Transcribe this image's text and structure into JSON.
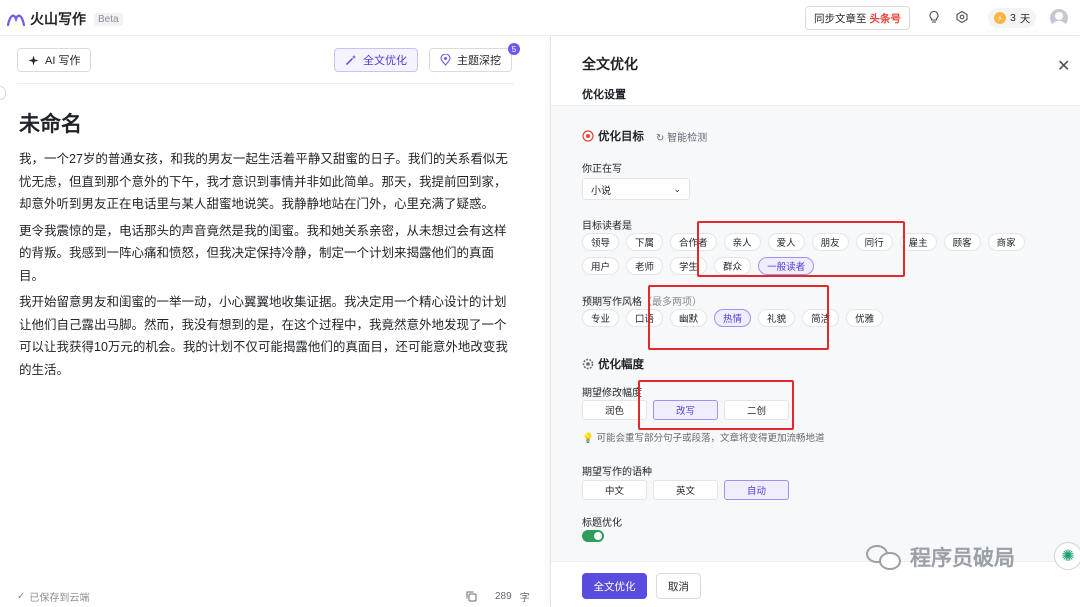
{
  "app": {
    "name": "火山写作",
    "badge": "Beta"
  },
  "topbar": {
    "sync_prefix": "同步文章至",
    "sync_target": "头条号",
    "days_value": "3",
    "days_unit": "天"
  },
  "editor": {
    "ai_button": "AI 写作",
    "optimize_button": "全文优化",
    "theme_button": "主题深挖",
    "theme_badge": "5",
    "title": "未命名",
    "paragraphs": [
      "我，一个27岁的普通女孩，和我的男友一起生活着平静又甜蜜的日子。我们的关系看似无忧无虑，但直到那个意外的下午，我才意识到事情并非如此简单。那天，我提前回到家，却意外听到男友正在电话里与某人甜蜜地说笑。我静静地站在门外，心里充满了疑惑。",
      "更令我震惊的是，电话那头的声音竟然是我的闺蜜。我和她关系亲密，从未想过会有这样的背叛。我感到一阵心痛和愤怒，但我决定保持冷静，制定一个计划来揭露他们的真面目。",
      "我开始留意男友和闺蜜的一举一动，小心翼翼地收集证据。我决定用一个精心设计的计划让他们自己露出马脚。然而，我没有想到的是，在这个过程中，我竟然意外地发现了一个可以让我获得10万元的机会。我的计划不仅可能揭露他们的真面目，还可能意外地改变我的生活。"
    ],
    "saved_status": "已保存到云端",
    "word_count": "289",
    "word_unit": "字"
  },
  "panel": {
    "title": "全文优化",
    "tab": "优化设置",
    "goal_heading": "优化目标",
    "smart_detect": "智能检测",
    "writing_label": "你正在写",
    "writing_value": "小说",
    "readers_label": "目标读者是",
    "readers": [
      "领导",
      "下属",
      "合作者",
      "亲人",
      "爱人",
      "朋友",
      "同行",
      "雇主",
      "顾客",
      "商家",
      "用户",
      "老师",
      "学生",
      "群众",
      "一般读者"
    ],
    "readers_selected": "一般读者",
    "style_label": "预期写作风格",
    "style_note": "（最多两项）",
    "styles": [
      "专业",
      "口语",
      "幽默",
      "热情",
      "礼貌",
      "简洁",
      "优雅"
    ],
    "styles_selected": "热情",
    "range_heading": "优化幅度",
    "range_label": "期望修改幅度",
    "ranges": [
      "润色",
      "改写",
      "二创"
    ],
    "range_selected": "改写",
    "range_hint": "可能会重写部分句子或段落，文章将变得更加流畅地道",
    "lang_label": "期望写作的语种",
    "langs": [
      "中文",
      "英文",
      "自动"
    ],
    "lang_selected": "自动",
    "title_opt_label": "标题优化",
    "title_opt_on": true,
    "primary_button": "全文优化",
    "cancel_button": "取消"
  },
  "watermark": {
    "text": "程序员破局"
  },
  "colors": {
    "accent": "#5b4ce0",
    "highlight_box": "#e12b2b",
    "toggle_on": "#2f9e5a"
  }
}
